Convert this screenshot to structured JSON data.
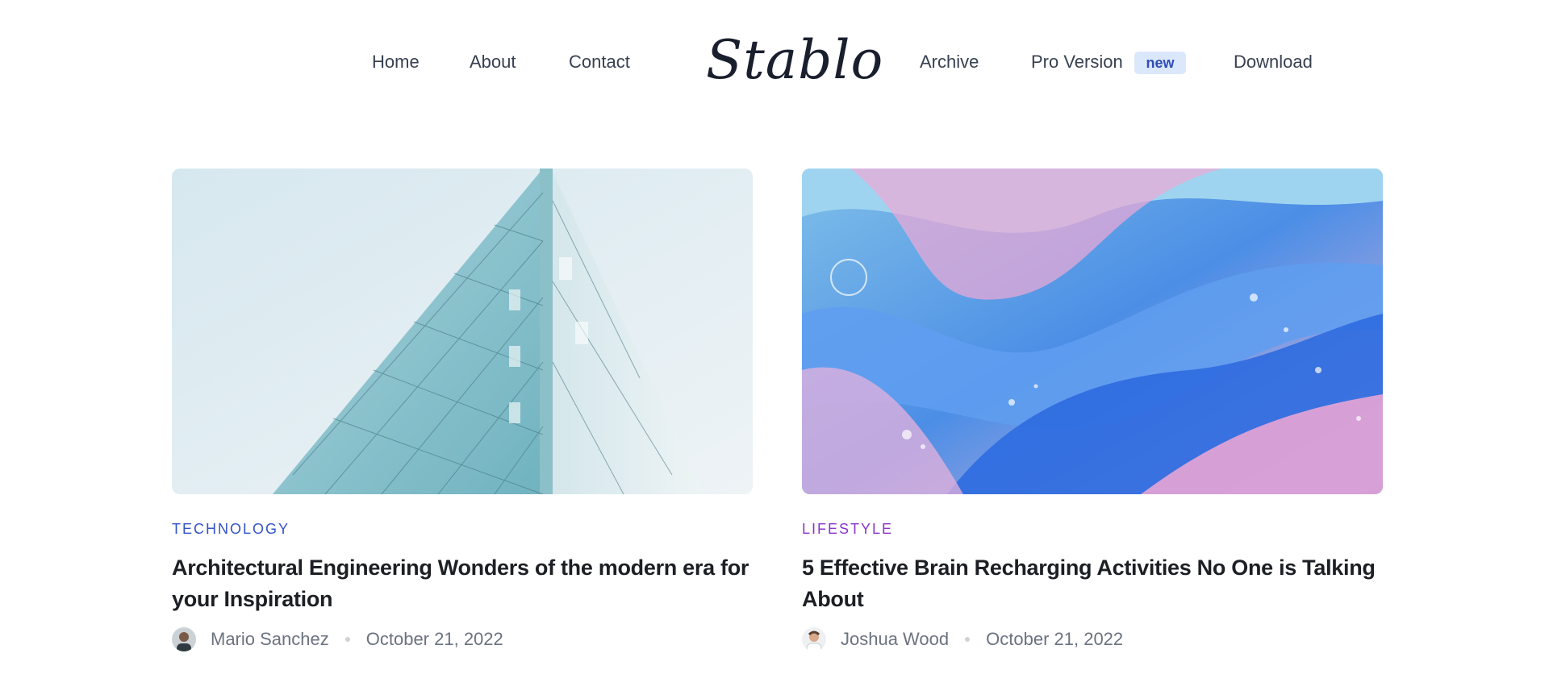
{
  "nav": {
    "home": "Home",
    "about": "About",
    "contact": "Contact",
    "logo": "Stablo",
    "archive": "Archive",
    "pro": "Pro Version",
    "pro_badge": "new",
    "download": "Download"
  },
  "posts": [
    {
      "category": "TECHNOLOGY",
      "category_color": "#3353c9",
      "title": "Architectural Engineering Wonders of the modern era for your Inspiration",
      "author": "Mario Sanchez",
      "date": "October 21, 2022",
      "image": "glass-building-photo"
    },
    {
      "category": "LIFESTYLE",
      "category_color": "#8a36c9",
      "title": "5 Effective Brain Recharging Activities No One is Talking About",
      "author": "Joshua Wood",
      "date": "October 21, 2022",
      "image": "fluid-paint-photo"
    }
  ]
}
